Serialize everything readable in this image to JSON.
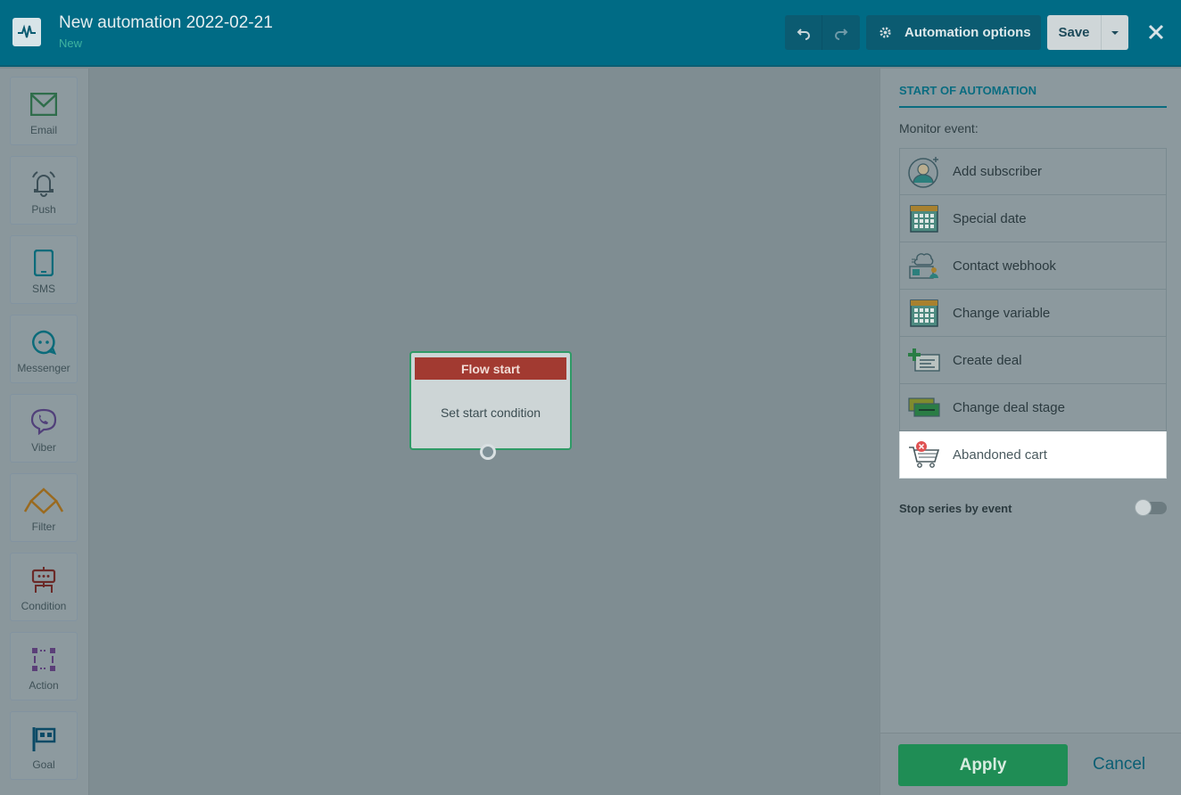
{
  "header": {
    "title": "New automation 2022-02-21",
    "status": "New",
    "automation_options_label": "Automation options",
    "save_label": "Save"
  },
  "toolbar": [
    {
      "label": "Email",
      "icon": "envelope-icon"
    },
    {
      "label": "Push",
      "icon": "bell-icon"
    },
    {
      "label": "SMS",
      "icon": "phone-icon"
    },
    {
      "label": "Messenger",
      "icon": "chat-icon"
    },
    {
      "label": "Viber",
      "icon": "viber-icon"
    },
    {
      "label": "Filter",
      "icon": "filter-icon"
    },
    {
      "label": "Condition",
      "icon": "condition-icon"
    },
    {
      "label": "Action",
      "icon": "action-icon"
    },
    {
      "label": "Goal",
      "icon": "goal-flag-icon"
    }
  ],
  "canvas": {
    "node": {
      "title": "Flow start",
      "body": "Set start condition"
    }
  },
  "panel": {
    "title": "START OF AUTOMATION",
    "monitor_label": "Monitor event:",
    "events": [
      {
        "label": "Add subscriber",
        "icon": "add-subscriber-icon"
      },
      {
        "label": "Special date",
        "icon": "calendar-icon"
      },
      {
        "label": "Contact webhook",
        "icon": "webhook-icon"
      },
      {
        "label": "Change variable",
        "icon": "calendar-grid-icon"
      },
      {
        "label": "Create deal",
        "icon": "create-deal-icon"
      },
      {
        "label": "Change deal stage",
        "icon": "deal-stage-icon"
      },
      {
        "label": "Abandoned cart",
        "icon": "abandoned-cart-icon"
      }
    ],
    "stop_series_label": "Stop series by event",
    "apply_label": "Apply",
    "cancel_label": "Cancel"
  },
  "colors": {
    "header_bg": "#006b85",
    "accent_green": "#1f8d55",
    "node_header": "#a23a31",
    "panel_accent": "#0a6c80"
  }
}
